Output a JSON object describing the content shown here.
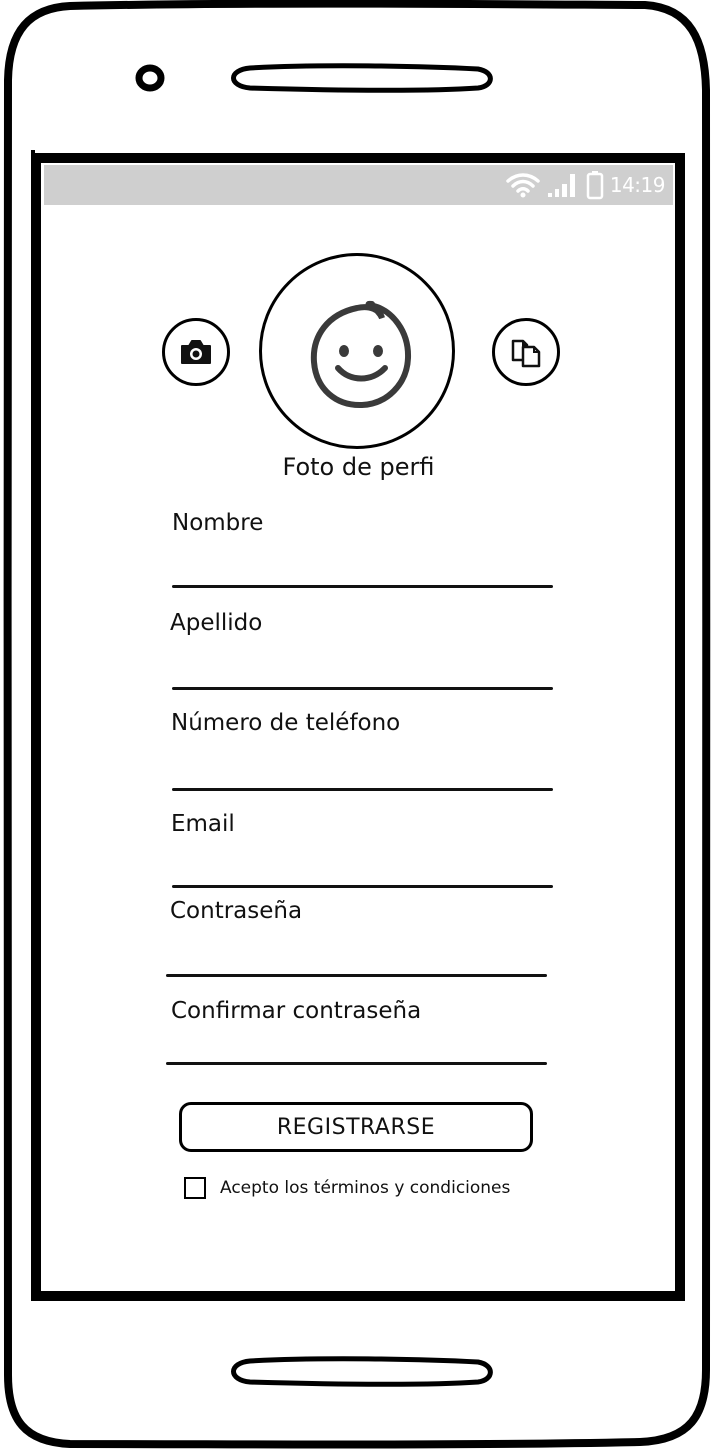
{
  "status_bar": {
    "time": "14:19",
    "icons": [
      "wifi-icon",
      "signal-icon",
      "battery-icon"
    ]
  },
  "profile": {
    "caption": "Foto de perfi",
    "avatar_icon": "smiley-face-icon",
    "left_button_icon": "camera-icon",
    "right_button_icon": "gallery-icon"
  },
  "form": {
    "fields": [
      {
        "label": "Nombre",
        "value": ""
      },
      {
        "label": "Apellido",
        "value": ""
      },
      {
        "label": "Número de teléfono",
        "value": ""
      },
      {
        "label": "Email",
        "value": ""
      },
      {
        "label": "Contraseña",
        "value": ""
      },
      {
        "label": "Confirmar contraseña",
        "value": ""
      }
    ],
    "submit_label": "REGISTRARSE",
    "terms_label": "Acepto los términos y condiciones",
    "terms_checked": false
  }
}
